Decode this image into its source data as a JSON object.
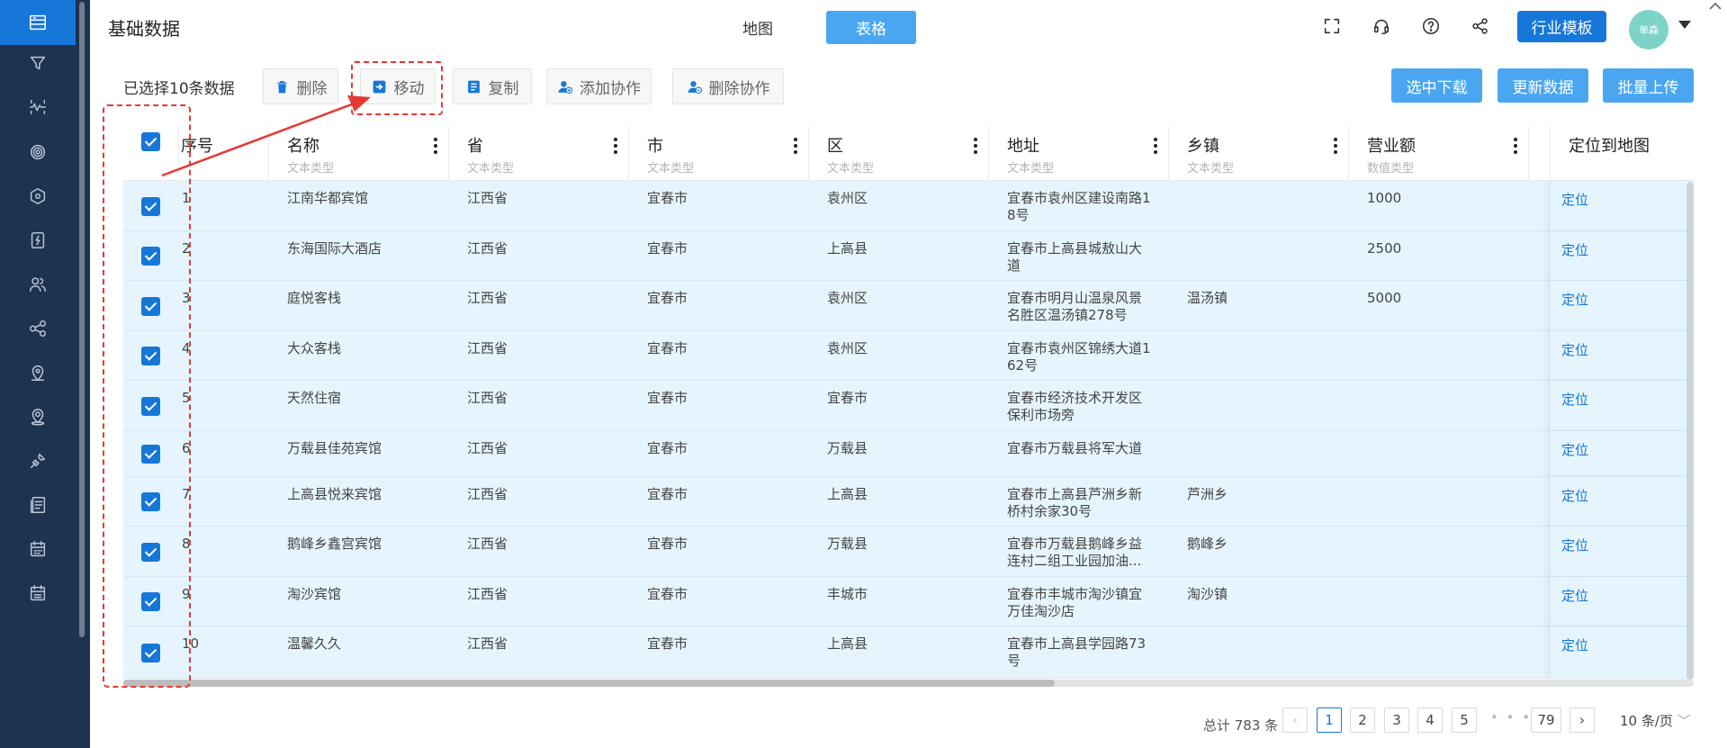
{
  "header": {
    "title": "基础数据",
    "view_map": "地图",
    "view_table": "表格",
    "industry_button": "行业模板",
    "avatar_text": "单森"
  },
  "toolbar": {
    "selected_count": "已选择10条数据",
    "delete": "删除",
    "move": "移动",
    "copy": "复制",
    "add_collab": "添加协作",
    "remove_collab": "删除协作",
    "download_selected": "选中下载",
    "update_data": "更新数据",
    "bulk_upload": "批量上传"
  },
  "table": {
    "columns": [
      {
        "title": "序号",
        "sub": ""
      },
      {
        "title": "名称",
        "sub": "文本类型"
      },
      {
        "title": "省",
        "sub": "文本类型"
      },
      {
        "title": "市",
        "sub": "文本类型"
      },
      {
        "title": "区",
        "sub": "文本类型"
      },
      {
        "title": "地址",
        "sub": "文本类型"
      },
      {
        "title": "乡镇",
        "sub": "文本类型"
      },
      {
        "title": "营业额",
        "sub": "数值类型"
      }
    ],
    "fixed_column_title": "定位到地图",
    "locate_label": "定位",
    "rows": [
      {
        "idx": "1",
        "name": "江南华都宾馆",
        "prov": "江西省",
        "city": "宜春市",
        "dist": "袁州区",
        "addr1": "宜春市袁州区建设南路1",
        "addr2": "8号",
        "town": "",
        "revenue": "1000"
      },
      {
        "idx": "2",
        "name": "东海国际大酒店",
        "prov": "江西省",
        "city": "宜春市",
        "dist": "上高县",
        "addr1": "宜春市上高县城敖山大",
        "addr2": "道",
        "town": "",
        "revenue": "2500"
      },
      {
        "idx": "3",
        "name": "庭悦客栈",
        "prov": "江西省",
        "city": "宜春市",
        "dist": "袁州区",
        "addr1": "宜春市明月山温泉风景",
        "addr2": "名胜区温汤镇278号",
        "town": "温汤镇",
        "revenue": "5000"
      },
      {
        "idx": "4",
        "name": "大众客栈",
        "prov": "江西省",
        "city": "宜春市",
        "dist": "袁州区",
        "addr1": "宜春市袁州区锦绣大道1",
        "addr2": "62号",
        "town": "",
        "revenue": ""
      },
      {
        "idx": "5",
        "name": "天然住宿",
        "prov": "江西省",
        "city": "宜春市",
        "dist": "宜春市",
        "addr1": "宜春市经济技术开发区",
        "addr2": "保利市场旁",
        "town": "",
        "revenue": ""
      },
      {
        "idx": "6",
        "name": "万载县佳苑宾馆",
        "prov": "江西省",
        "city": "宜春市",
        "dist": "万载县",
        "addr1": "宜春市万载县将军大道",
        "addr2": "",
        "town": "",
        "revenue": ""
      },
      {
        "idx": "7",
        "name": "上高县悦来宾馆",
        "prov": "江西省",
        "city": "宜春市",
        "dist": "上高县",
        "addr1": "宜春市上高县芦洲乡新",
        "addr2": "桥村余家30号",
        "town": "芦洲乡",
        "revenue": ""
      },
      {
        "idx": "8",
        "name": "鹅峰乡鑫宫宾馆",
        "prov": "江西省",
        "city": "宜春市",
        "dist": "万载县",
        "addr1": "宜春市万载县鹅峰乡益",
        "addr2": "连村二组工业园加油...",
        "town": "鹅峰乡",
        "revenue": ""
      },
      {
        "idx": "9",
        "name": "淘沙宾馆",
        "prov": "江西省",
        "city": "宜春市",
        "dist": "丰城市",
        "addr1": "宜春市丰城市淘沙镇宜",
        "addr2": "万佳淘沙店",
        "town": "淘沙镇",
        "revenue": ""
      },
      {
        "idx": "10",
        "name": "温馨久久",
        "prov": "江西省",
        "city": "宜春市",
        "dist": "上高县",
        "addr1": "宜春市上高县学园路73",
        "addr2": "号",
        "town": "",
        "revenue": ""
      }
    ]
  },
  "pagination": {
    "total": "总计 783 条",
    "pages": [
      "1",
      "2",
      "3",
      "4",
      "5"
    ],
    "ellipsis": "• • •",
    "last": "79",
    "page_size": "10 条/页"
  },
  "colors": {
    "sidebar_bg": "#1e3350",
    "primary": "#1677d9",
    "light_primary": "#4aa6f0",
    "row_selected_bg": "#e6f5fd",
    "annotation_red": "#e53935"
  }
}
